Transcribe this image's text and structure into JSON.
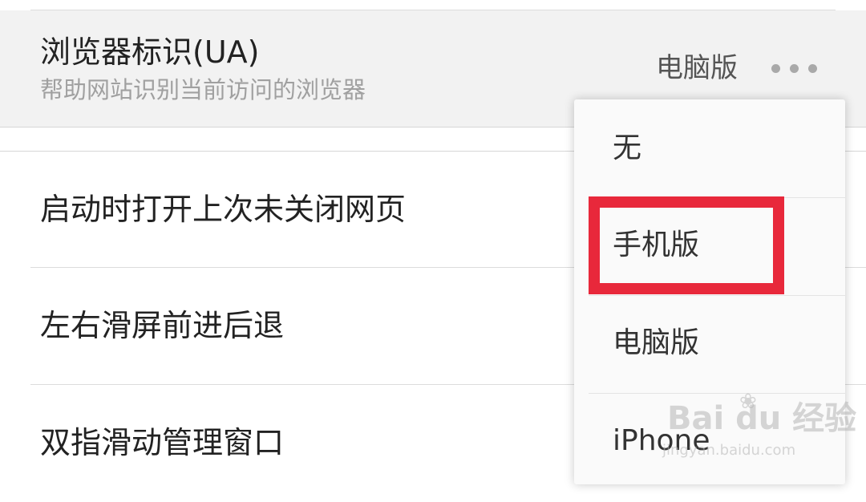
{
  "ua_setting": {
    "title": "浏览器标识(UA)",
    "subtitle": "帮助网站识别当前访问的浏览器",
    "current_value": "电脑版",
    "more_icon": "more-horizontal-icon"
  },
  "settings": [
    {
      "label": "启动时打开上次未关闭网页"
    },
    {
      "label": "左右滑屏前进后退"
    },
    {
      "label": "双指滑动管理窗口"
    }
  ],
  "dropdown": {
    "options": [
      {
        "label": "无"
      },
      {
        "label": "手机版"
      },
      {
        "label": "电脑版"
      },
      {
        "label": "iPhone"
      }
    ]
  },
  "annotation": {
    "highlight_color": "#e8283b"
  },
  "watermark": {
    "brand": "Bai du 经验",
    "url": "jingyan.baidu.com"
  },
  "colors": {
    "header_bg": "#f2f2f2",
    "dropdown_bg": "#fafafa",
    "subtitle": "#a0a0a0"
  }
}
